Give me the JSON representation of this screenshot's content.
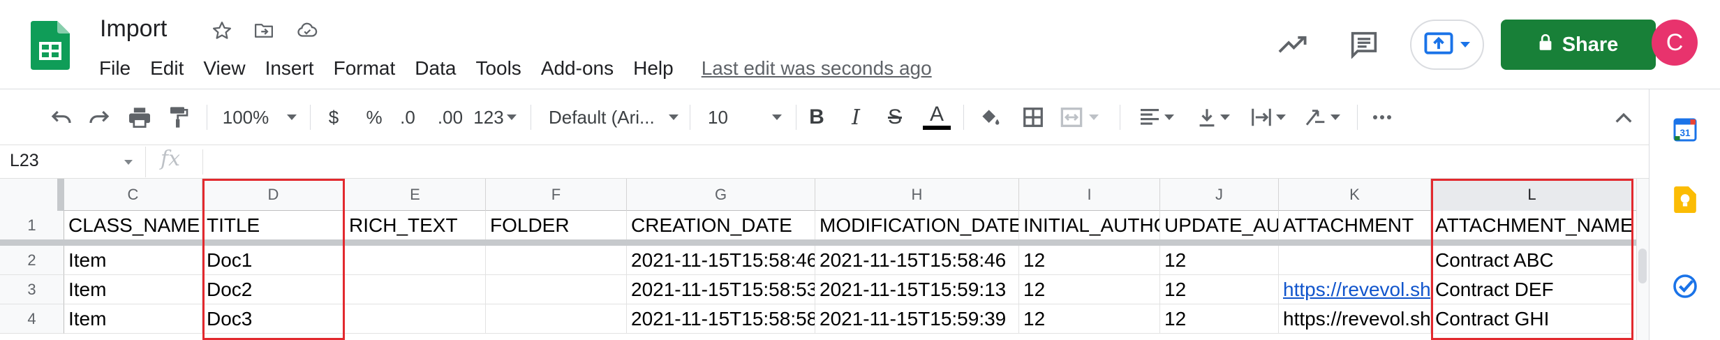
{
  "app": {
    "doc_title": "Import",
    "menu": [
      "File",
      "Edit",
      "View",
      "Insert",
      "Format",
      "Data",
      "Tools",
      "Add-ons",
      "Help"
    ],
    "last_edit": "Last edit was seconds ago",
    "share_label": "Share",
    "avatar_initial": "C",
    "brand_green": "#188038",
    "avatar_color": "#e8336d"
  },
  "toolbar": {
    "zoom": "100%",
    "currency": "$",
    "percent": "%",
    "decrease_decimals": ".0",
    "increase_decimals": ".00",
    "more_formats": "123",
    "font": "Default (Ari...",
    "font_size": "10",
    "bold": "B",
    "italic": "I",
    "strikethrough": "S",
    "text_color": "A"
  },
  "formula_bar": {
    "name_box": "L23",
    "fx": "fx",
    "value": ""
  },
  "grid": {
    "columns": [
      "C",
      "D",
      "E",
      "F",
      "G",
      "H",
      "I",
      "J",
      "K",
      "L"
    ],
    "selected_column": "L",
    "rows": [
      {
        "num": "1",
        "cells": [
          "CLASS_NAME",
          "TITLE",
          "RICH_TEXT",
          "FOLDER",
          "CREATION_DATE",
          "MODIFICATION_DATE",
          "INITIAL_AUTHO",
          "UPDATE_AU",
          "ATTACHMENT",
          "ATTACHMENT_NAME"
        ]
      },
      {
        "num": "2",
        "cells": [
          "Item",
          "Doc1",
          "",
          "",
          "2021-11-15T15:58:46",
          "2021-11-15T15:58:46",
          "12",
          "12",
          "",
          "Contract ABC"
        ]
      },
      {
        "num": "3",
        "cells": [
          "Item",
          "Doc2",
          "",
          "",
          "2021-11-15T15:58:53",
          "2021-11-15T15:59:13",
          "12",
          "12",
          "https://revevol.sha",
          "Contract DEF"
        ]
      },
      {
        "num": "4",
        "cells": [
          "Item",
          "Doc3",
          "",
          "",
          "2021-11-15T15:58:58",
          "2021-11-15T15:59:39",
          "12",
          "12",
          "https://revevol.sha",
          "Contract GHI"
        ]
      }
    ],
    "link_cells": [
      "K3"
    ],
    "highlight_color": "#e2292e"
  }
}
